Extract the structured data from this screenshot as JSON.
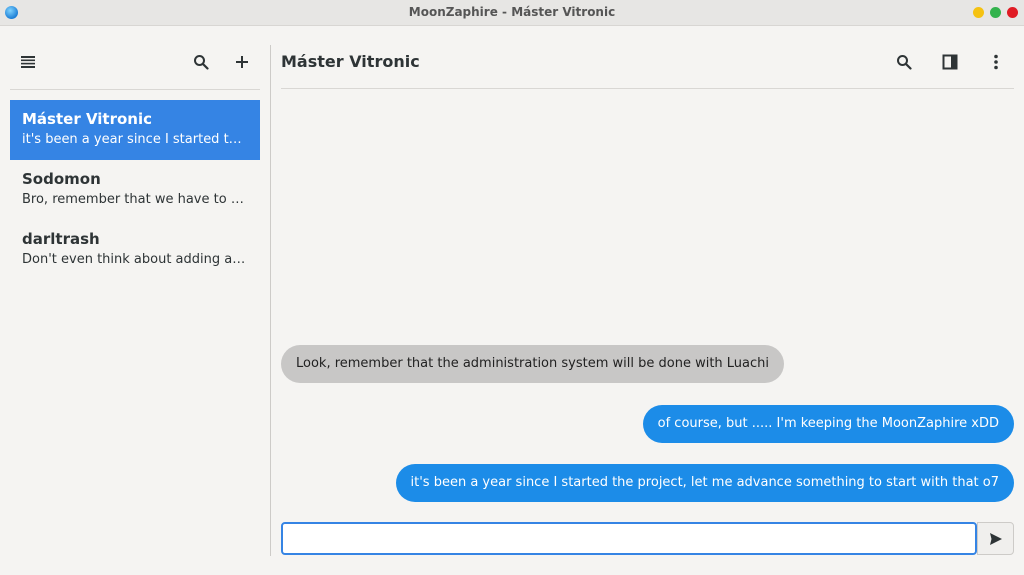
{
  "window": {
    "title": "MoonZaphire - Máster Vitronic"
  },
  "sidebar": {
    "chats": [
      {
        "name": "Máster Vitronic",
        "preview": "it's been a year since I started the pr…",
        "active": true
      },
      {
        "name": "Sodomon",
        "preview": "Bro, remember that we have to sup…",
        "active": false
      },
      {
        "name": "darltrash",
        "preview": "Don't even think about adding a he…",
        "active": false
      }
    ]
  },
  "conversation": {
    "title": "Máster Vitronic",
    "messages": [
      {
        "direction": "incoming",
        "text": "Look, remember that the administration system will be done with Luachi"
      },
      {
        "direction": "outgoing",
        "text": "of course, but ..... I'm keeping the MoonZaphire xDD"
      },
      {
        "direction": "outgoing",
        "text": "it's been a year since I started the project, let me advance something to start with that o7"
      }
    ]
  },
  "composer": {
    "value": "",
    "placeholder": ""
  },
  "colors": {
    "accent": "#3584e4",
    "outgoing_bubble": "#1c8ce8",
    "incoming_bubble": "#c8c7c6"
  }
}
